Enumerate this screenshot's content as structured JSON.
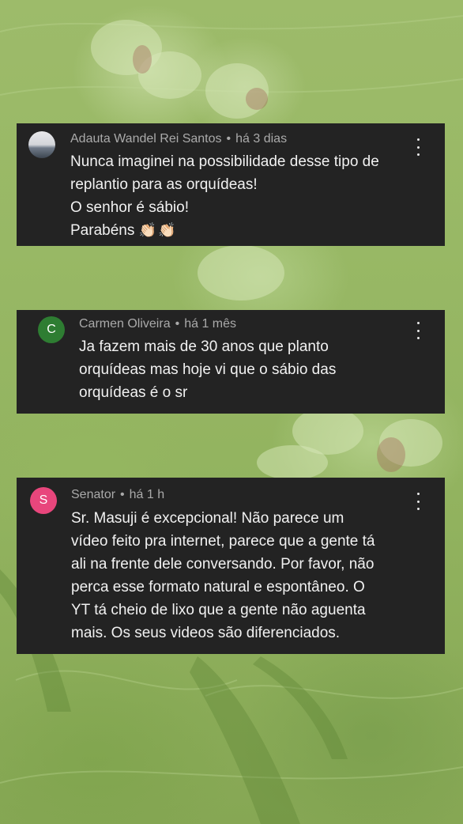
{
  "comments": [
    {
      "author": "Adauta Wandel Rei Santos",
      "time": "há 3 dias",
      "avatar_letter": "",
      "avatar_color": "",
      "lines": [
        "Nunca imaginei na possibilidade desse tipo de",
        "replantio para as orquídeas!",
        "O senhor é sábio!",
        "Parabéns"
      ],
      "emoji": "👏🏻👏🏻"
    },
    {
      "author": "Carmen Oliveira",
      "time": "há 1 mês",
      "avatar_letter": "C",
      "avatar_color": "#2e7d32",
      "lines": [
        "Ja fazem mais de 30 anos que planto",
        "orquídeas mas hoje vi que o sábio das",
        "orquídeas é o sr"
      ]
    },
    {
      "author": "Senator",
      "time": "há 1 h",
      "avatar_letter": "S",
      "avatar_color": "#e8467c",
      "lines": [
        "Sr. Masuji é excepcional! Não parece um",
        "vídeo feito pra internet, parece que a gente tá",
        "ali na frente dele conversando. Por favor, não",
        "perca esse formato natural e espontâneo. O",
        "YT tá cheio de lixo que a gente não aguenta",
        "mais. Os seus videos são diferenciados."
      ]
    }
  ],
  "separator": "•",
  "icons": {
    "more": "more-vert-icon"
  }
}
